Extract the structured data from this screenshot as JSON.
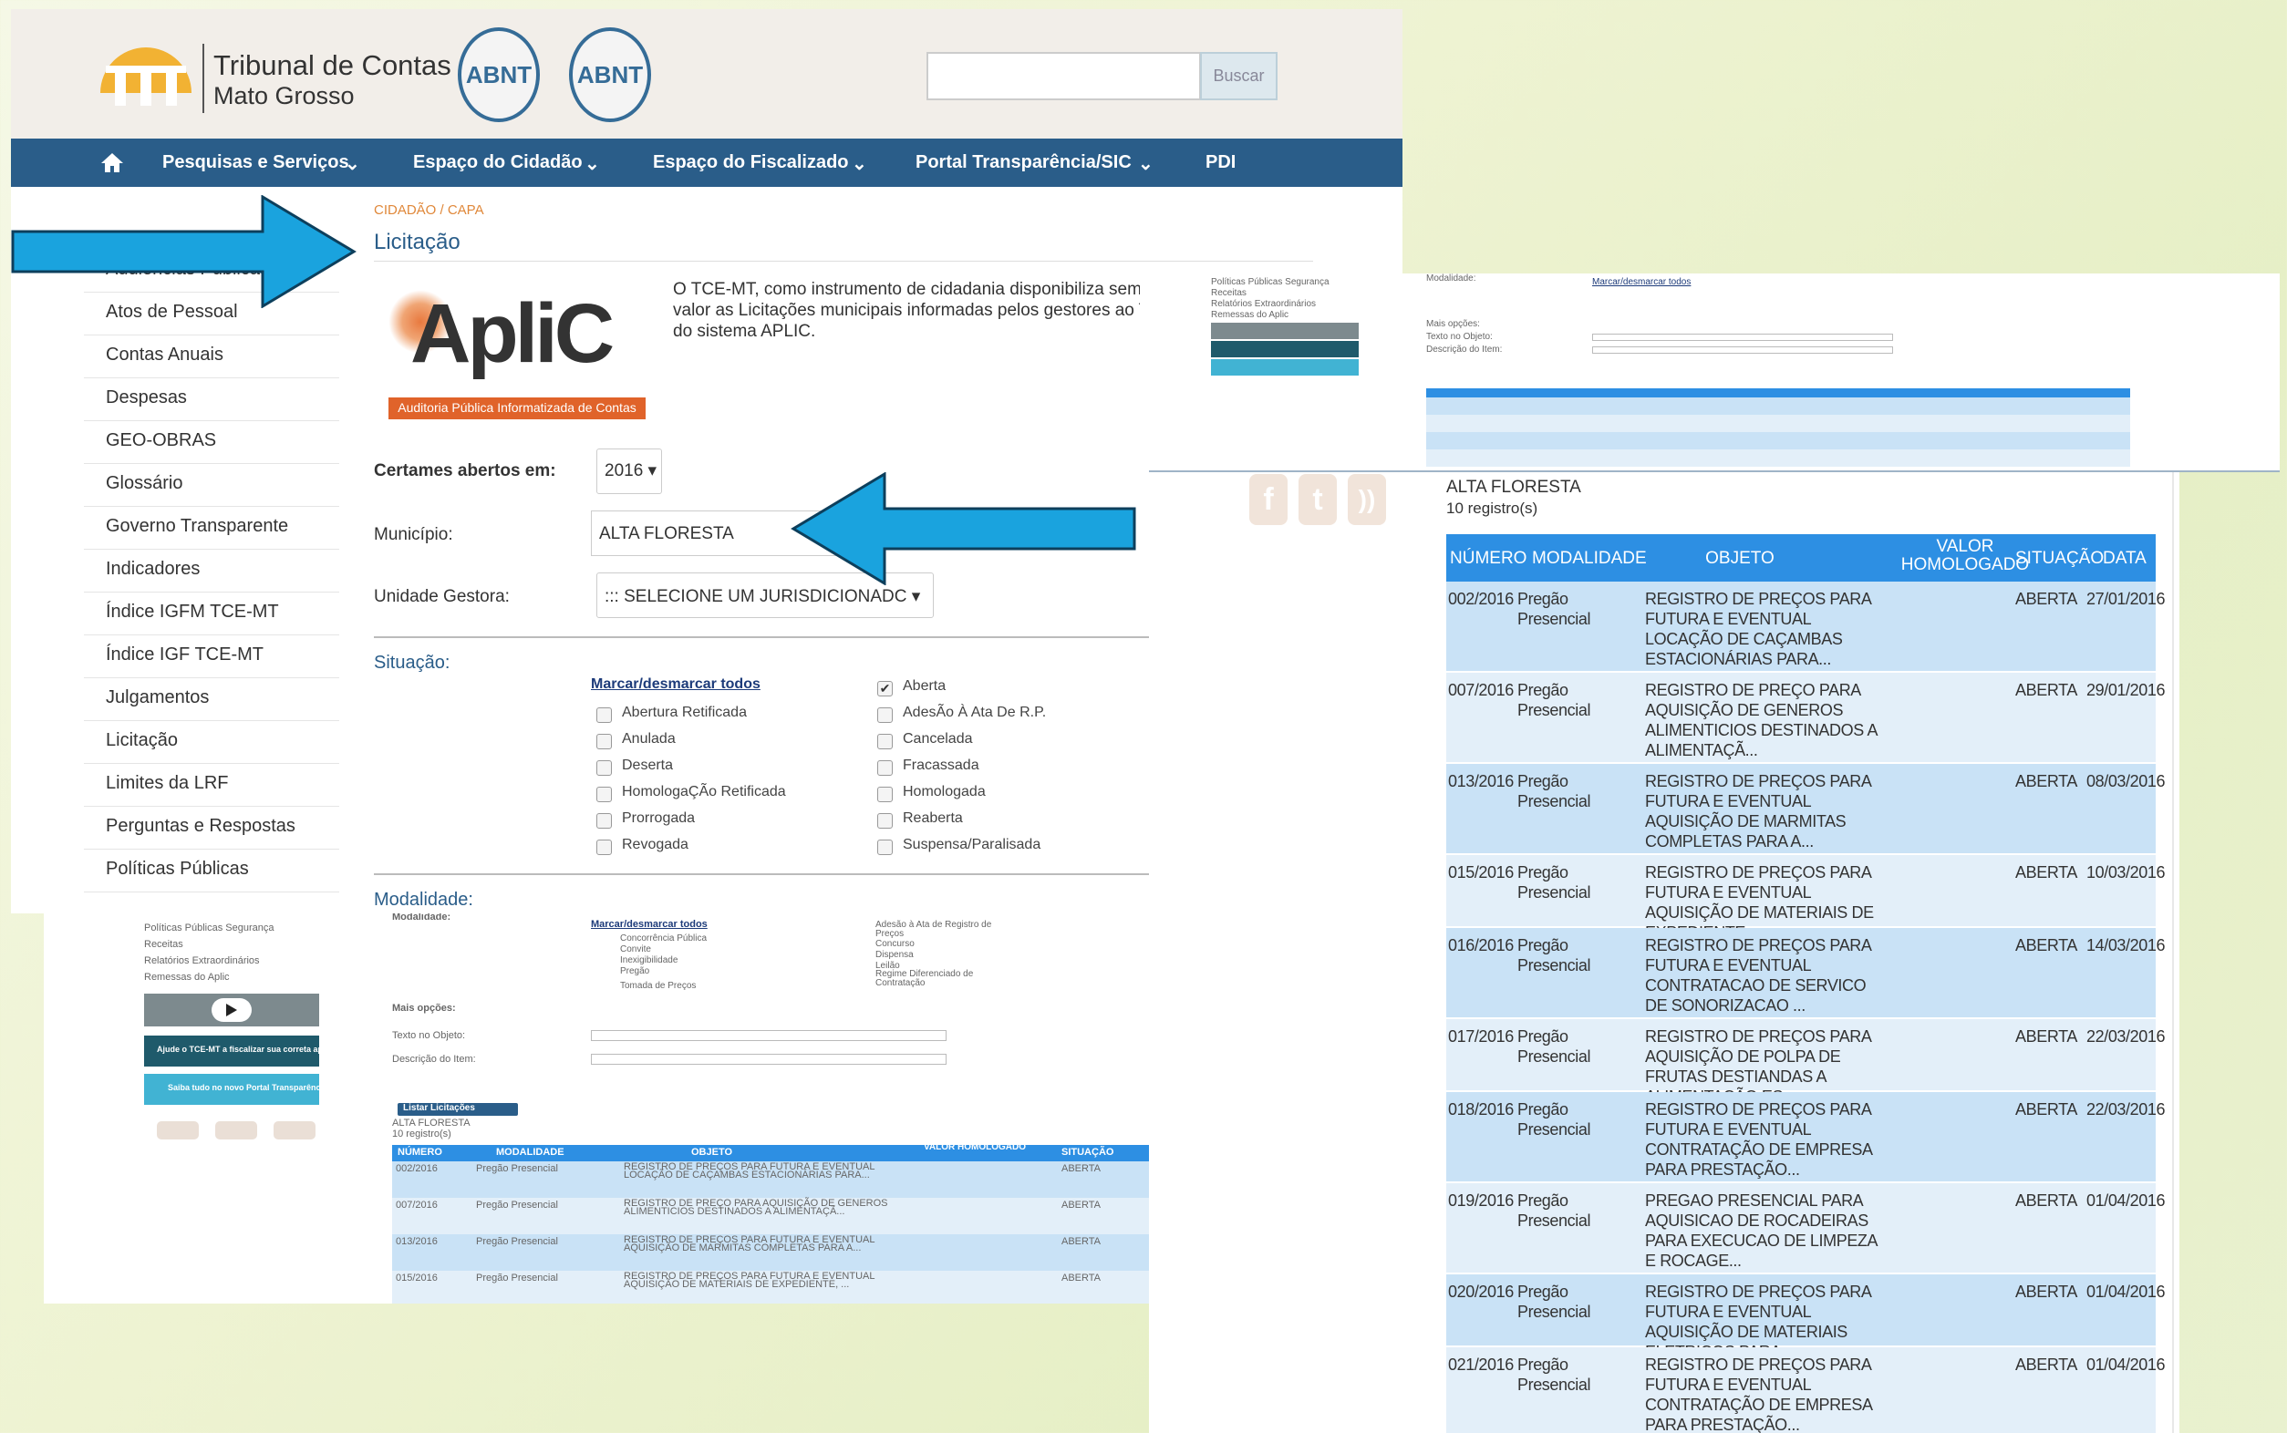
{
  "brand": {
    "line1": "Tribunal de Contas",
    "line2": "Mato Grosso",
    "seal": "ABNT"
  },
  "search": {
    "placeholder": "",
    "button": "Buscar"
  },
  "nav": [
    "Pesquisas e Serviços",
    "Espaço do Cidadão",
    "Espaço do Fiscalizado",
    "Portal Transparência/SIC",
    "PDI"
  ],
  "breadcrumb": "CIDADÃO / CAPA",
  "page_title": "Licitação",
  "sidebar": [
    "Audiências Públicas",
    "Atos de Pessoal",
    "Contas Anuais",
    "Despesas",
    "GEO-OBRAS",
    "Glossário",
    "Governo Transparente",
    "Indicadores",
    "Índice IGFM TCE-MT",
    "Índice IGF TCE-MT",
    "Julgamentos",
    "Licitação",
    "Limites da LRF",
    "Perguntas e Respostas",
    "Políticas Públicas"
  ],
  "aplic": {
    "logo": "ApliC",
    "tagline": "Auditoria Pública Informatizada de Contas"
  },
  "intro": [
    "O TCE-MT, como instrumento de cidadania disponibiliza sem",
    "valor as Licitações municipais informadas pelos gestores ao T",
    "do sistema APLIC."
  ],
  "form": {
    "year_label": "Certames abertos em:",
    "year": "2016",
    "municipio_label": "Município:",
    "municipio": "ALTA FLORESTA",
    "unidade_label": "Unidade Gestora:",
    "unidade": "::: SELECIONE UM JURISDICIONADC"
  },
  "situacao": {
    "title": "Situação:",
    "toggle": "Marcar/desmarcar todos",
    "left": [
      "Abertura Retificada",
      "Anulada",
      "Deserta",
      "HomologaÇÃo Retificada",
      "Prorrogada",
      "Revogada"
    ],
    "right": [
      "Aberta",
      "AdesÃo À Ata De R.P.",
      "Cancelada",
      "Fracassada",
      "Homologada",
      "Reaberta",
      "Suspensa/Paralisada"
    ]
  },
  "modalidade": {
    "title": "Modalidade:"
  },
  "small_view": {
    "menu": [
      "Políticas Públicas Segurança",
      "Receitas",
      "Relatórios Extraordinários",
      "Remessas do Aplic"
    ],
    "modalidade_label": "Modalidade:",
    "toggle": "Marcar/desmarcar todos",
    "mod_left": [
      "Concorrência Pública",
      "Convite",
      "Inexigibilidade",
      "Pregão",
      "Tomada de Preços"
    ],
    "mod_right": [
      "Adesão à Ata de Registro de Preços",
      "Concurso",
      "Dispensa",
      "Leilão",
      "Regime Diferenciado de Contratação"
    ],
    "mais_opcoes": "Mais opções:",
    "texto_objeto": "Texto no Objeto:",
    "descricao_item": "Descrição do Item:",
    "listar": "Listar Licitações",
    "banner1": "Ajude o TCE-MT a fiscalizar sua correta aplicação",
    "banner2": "Saiba tudo no novo Portal Transparência",
    "headers": [
      "NÚMERO",
      "MODALIDADE",
      "OBJETO",
      "VALOR HOMOLOGADO",
      "SITUAÇÃO"
    ],
    "rows": [
      [
        "002/2016",
        "Pregão Presencial",
        "REGISTRO DE PREÇOS PARA FUTURA E EVENTUAL LOCAÇÃO DE CAÇAMBAS ESTACIONÁRIAS PARA...",
        "ABERTA"
      ],
      [
        "007/2016",
        "Pregão Presencial",
        "REGISTRO DE PREÇO PARA AQUISIÇÃO DE GENEROS ALIMENTICIOS DESTINADOS A ALIMENTAÇÃ...",
        "ABERTA"
      ],
      [
        "013/2016",
        "Pregão Presencial",
        "REGISTRO DE PREÇOS PARA FUTURA E EVENTUAL AQUISIÇÃO DE MARMITAS COMPLETAS PARA A...",
        "ABERTA"
      ],
      [
        "015/2016",
        "Pregão Presencial",
        "REGISTRO DE PREÇOS PARA FUTURA E EVENTUAL AQUISIÇÃO DE MATERIAIS DE EXPEDIENTE, ...",
        "ABERTA"
      ]
    ]
  },
  "results": {
    "city": "ALTA FLORESTA",
    "count": "10 registro(s)",
    "headers": [
      "NÚMERO",
      "MODALIDADE",
      "OBJETO",
      "VALOR HOMOLOGADO",
      "SITUAÇÃO",
      "DATA"
    ],
    "rows": [
      {
        "num": "002/2016",
        "mod": "Pregão Presencial",
        "obj": "REGISTRO DE PREÇOS PARA FUTURA E EVENTUAL LOCAÇÃO DE CAÇAMBAS ESTACIONÁRIAS PARA...",
        "sit": "ABERTA",
        "data": "27/01/2016"
      },
      {
        "num": "007/2016",
        "mod": "Pregão Presencial",
        "obj": "REGISTRO DE PREÇO PARA AQUISIÇÃO DE GENEROS ALIMENTICIOS DESTINADOS A ALIMENTAÇÃ...",
        "sit": "ABERTA",
        "data": "29/01/2016"
      },
      {
        "num": "013/2016",
        "mod": "Pregão Presencial",
        "obj": "REGISTRO DE PREÇOS PARA FUTURA E EVENTUAL AQUISIÇÃO DE MARMITAS COMPLETAS PARA A...",
        "sit": "ABERTA",
        "data": "08/03/2016"
      },
      {
        "num": "015/2016",
        "mod": "Pregão Presencial",
        "obj": "REGISTRO DE PREÇOS PARA FUTURA E EVENTUAL AQUISIÇÃO DE MATERIAIS DE EXPEDIENTE, ...",
        "sit": "ABERTA",
        "data": "10/03/2016"
      },
      {
        "num": "016/2016",
        "mod": "Pregão Presencial",
        "obj": "REGISTRO DE PREÇOS PARA FUTURA E EVENTUAL CONTRATACAO DE SERVICO DE SONORIZACAO ...",
        "sit": "ABERTA",
        "data": "14/03/2016"
      },
      {
        "num": "017/2016",
        "mod": "Pregão Presencial",
        "obj": "REGISTRO DE PREÇOS PARA AQUISIÇÃO DE POLPA DE FRUTAS DESTIANDAS A ALIMENTAÇÃO ES...",
        "sit": "ABERTA",
        "data": "22/03/2016"
      },
      {
        "num": "018/2016",
        "mod": "Pregão Presencial",
        "obj": "REGISTRO DE PREÇOS PARA FUTURA E EVENTUAL CONTRATAÇÃO DE EMPRESA PARA PRESTAÇÃO...",
        "sit": "ABERTA",
        "data": "22/03/2016"
      },
      {
        "num": "019/2016",
        "mod": "Pregão Presencial",
        "obj": "PREGAO PRESENCIAL PARA AQUISICAO DE ROCADEIRAS PARA EXECUCAO DE LIMPEZA E ROCAGE...",
        "sit": "ABERTA",
        "data": "01/04/2016"
      },
      {
        "num": "020/2016",
        "mod": "Pregão Presencial",
        "obj": "REGISTRO DE PREÇOS PARA FUTURA E EVENTUAL AQUISIÇÃO DE MATERIAIS ELETRICOS PARA ...",
        "sit": "ABERTA",
        "data": "01/04/2016"
      },
      {
        "num": "021/2016",
        "mod": "Pregão Presencial",
        "obj": "REGISTRO DE PREÇOS PARA FUTURA E EVENTUAL CONTRATAÇÃO DE EMPRESA PARA PRESTAÇÃO...",
        "sit": "ABERTA",
        "data": "01/04/2016"
      }
    ]
  },
  "colors": {
    "nav": "#2a5d89",
    "table_header": "#2d8fe3",
    "row_a": "#c9e2f6",
    "row_b": "#e3eff9",
    "arrow": "#1aa3de",
    "aplic_orange": "#e0632a"
  },
  "icons": [
    "home-icon",
    "chevron-down-icon",
    "facebook-icon",
    "twitter-icon",
    "rss-icon",
    "play-icon",
    "checkbox-icon",
    "arrow-right-icon",
    "arrow-left-icon"
  ]
}
